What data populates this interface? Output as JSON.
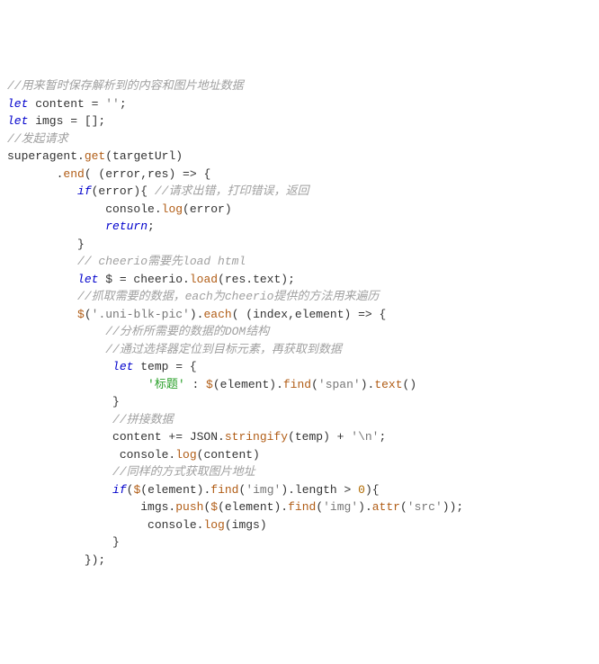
{
  "code": {
    "t01": "//用来暂时保存解析到的内容和图片地址数据",
    "t02a": "let",
    "t02b": " content = ",
    "t02c": "''",
    "t02d": ";",
    "t03a": "let",
    "t03b": " imgs = [];",
    "t04": "//发起请求",
    "t05a": "superagent.",
    "t05b": "get",
    "t05c": "(targetUrl)",
    "t06a": "       .",
    "t06b": "end",
    "t06c": "( (error,res) => {",
    "t07a": "          ",
    "t07b": "if",
    "t07c": "(error){ ",
    "t07d": "//请求出错，打印错误，返回",
    "t08a": "              console.",
    "t08b": "log",
    "t08c": "(error)",
    "t09a": "              ",
    "t09b": "return",
    "t09c": ";",
    "t10": "          }",
    "t11a": "          ",
    "t11b": "// cheerio需要先load html",
    "t12a": "          ",
    "t12b": "let",
    "t12c": " $ = cheerio.",
    "t12d": "load",
    "t12e": "(res.text);",
    "t13a": "          ",
    "t13b": "//抓取需要的数据，each为cheerio提供的方法用来遍历",
    "t14a": "          ",
    "t14b": "$",
    "t14c": "(",
    "t14d": "'.uni-blk-pic'",
    "t14e": ").",
    "t14f": "each",
    "t14g": "( (index,element) => {",
    "t15a": "              ",
    "t15b": "//分析所需要的数据的DOM结构",
    "t16a": "              ",
    "t16b": "//通过选择器定位到目标元素，再获取到数据",
    "t17a": "               ",
    "t17b": "let",
    "t17c": " temp = {",
    "t18a": "                    ",
    "t18b": "'标题'",
    "t18c": " : ",
    "t18d": "$",
    "t18e": "(element).",
    "t18f": "find",
    "t18g": "(",
    "t18h": "'span'",
    "t18i": ").",
    "t18j": "text",
    "t18k": "()",
    "t19": "               }",
    "t20a": "               ",
    "t20b": "//拼接数据",
    "t21a": "               content += JSON.",
    "t21b": "stringify",
    "t21c": "(temp) + ",
    "t21d": "'\\n'",
    "t21e": ";",
    "t22a": "                console.",
    "t22b": "log",
    "t22c": "(content)",
    "t23a": "               ",
    "t23b": "//同样的方式获取图片地址",
    "t24a": "               ",
    "t24b": "if",
    "t24c": "(",
    "t24d": "$",
    "t24e": "(element).",
    "t24f": "find",
    "t24g": "(",
    "t24h": "'img'",
    "t24i": ").length > ",
    "t24j": "0",
    "t24k": "){",
    "t25a": "                   imgs.",
    "t25b": "push",
    "t25c": "(",
    "t25d": "$",
    "t25e": "(element).",
    "t25f": "find",
    "t25g": "(",
    "t25h": "'img'",
    "t25i": ").",
    "t25j": "attr",
    "t25k": "(",
    "t25l": "'src'",
    "t25m": "));",
    "t26a": "                    console.",
    "t26b": "log",
    "t26c": "(imgs)",
    "t27": "               }",
    "t28": "           });"
  }
}
